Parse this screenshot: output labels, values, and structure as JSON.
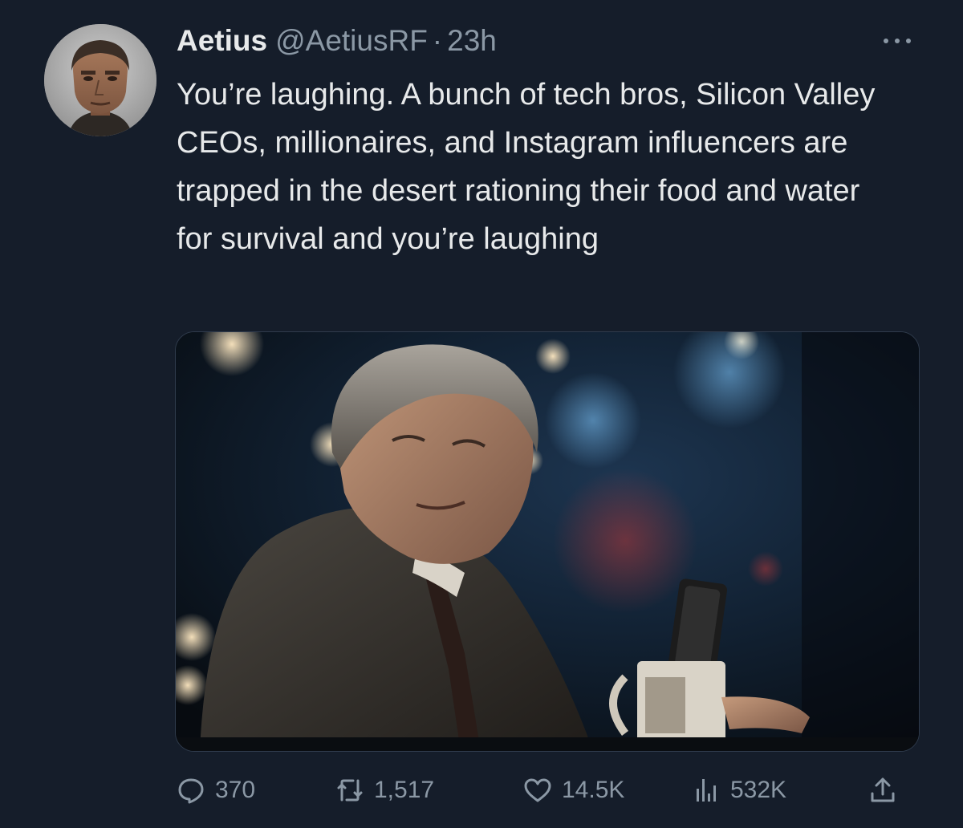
{
  "tweet": {
    "display_name": "Aetius",
    "handle": "@AetiusRF",
    "separator": "·",
    "time": "23h",
    "text": "You’re laughing. A bunch of tech bros, Silicon Valley CEOs, millionaires, and Instagram influencers are trapped in the desert rationing their food and water for survival and you’re laughing"
  },
  "actions": {
    "replies": "370",
    "retweets": "1,517",
    "likes": "14.5K",
    "views": "532K"
  },
  "icons": {
    "more": "more-horizontal-icon",
    "reply": "reply-icon",
    "retweet": "retweet-icon",
    "like": "heart-icon",
    "views": "analytics-icon",
    "share": "share-icon"
  },
  "colors": {
    "background": "#151d2a",
    "text_primary": "#e7e9ea",
    "text_secondary": "#8b98a5"
  }
}
